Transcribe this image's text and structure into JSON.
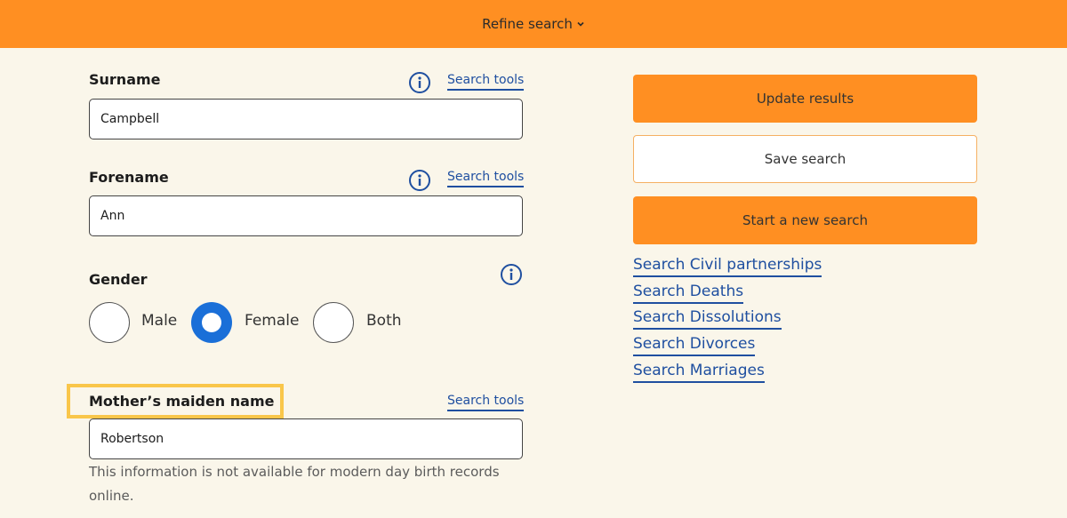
{
  "header": {
    "refine_label": "Refine search",
    "chevron_icon": "chevron-down-icon"
  },
  "form": {
    "surname": {
      "label": "Surname",
      "tools_label": "Search tools",
      "value": "Campbell",
      "info_icon": "info-icon"
    },
    "forename": {
      "label": "Forename",
      "tools_label": "Search tools",
      "value": "Ann",
      "info_icon": "info-icon"
    },
    "gender": {
      "label": "Gender",
      "info_icon": "info-icon",
      "options": [
        {
          "label": "Male",
          "selected": false
        },
        {
          "label": "Female",
          "selected": true
        },
        {
          "label": "Both",
          "selected": false
        }
      ]
    },
    "mothers_maiden_name": {
      "label": "Mother’s maiden name",
      "tools_label": "Search tools",
      "value": "Robertson",
      "hint": "This information is not available for modern day birth records online."
    }
  },
  "actions": {
    "update_label": "Update results",
    "save_label": "Save search",
    "new_search_label": "Start a new search"
  },
  "links": [
    "Search Civil partnerships",
    "Search Deaths",
    "Search Dissolutions",
    "Search Divorces",
    "Search Marriages"
  ],
  "colors": {
    "accent": "#ff8f22",
    "link": "#1f4fa0",
    "radio_selected": "#1a6fd8",
    "highlight": "#f9c64a",
    "background": "#faf6ea"
  }
}
